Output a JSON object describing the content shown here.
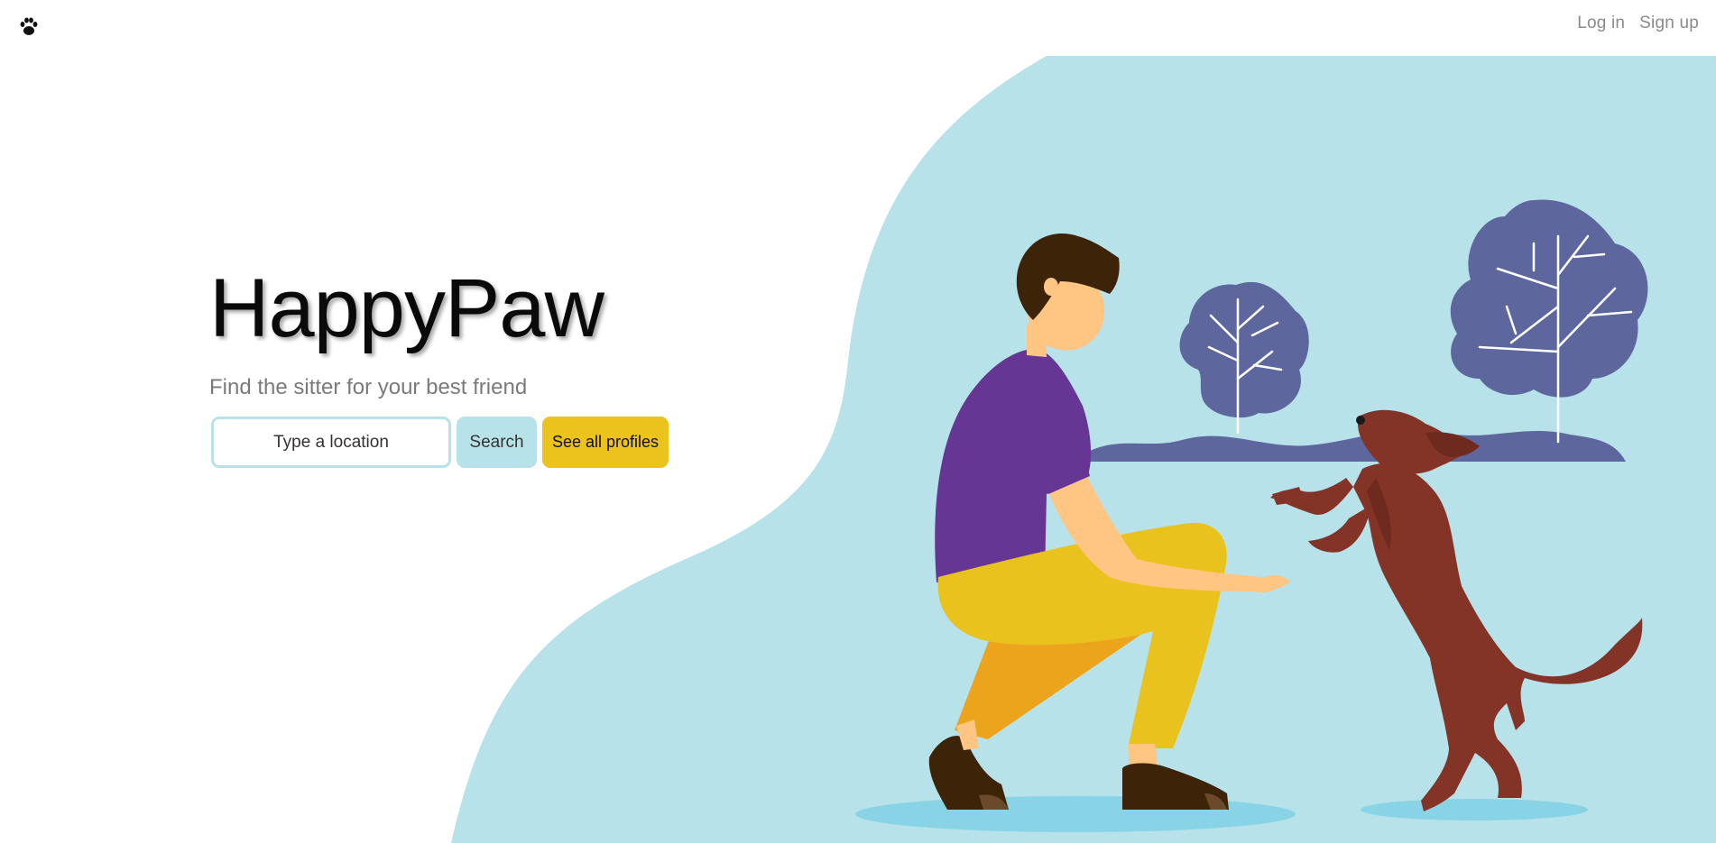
{
  "header": {
    "logo_icon": "paw-icon",
    "nav": {
      "login_label": "Log in",
      "signup_label": "Sign up"
    }
  },
  "hero": {
    "title": "HappyPaw",
    "subtitle": "Find the sitter for your best friend",
    "search": {
      "placeholder": "Type a location",
      "value": ""
    },
    "search_button": "Search",
    "profiles_button": "See all profiles"
  },
  "colors": {
    "accent_blue": "#b7e2ea",
    "accent_yellow": "#ecc21d",
    "tree_purple": "#5e679d",
    "shirt_purple": "#663695",
    "dog_brown": "#843427"
  },
  "illustration": {
    "icons": [
      "person-kneeling-illustration",
      "dog-jumping-illustration",
      "tree-icon",
      "tree-icon"
    ]
  }
}
